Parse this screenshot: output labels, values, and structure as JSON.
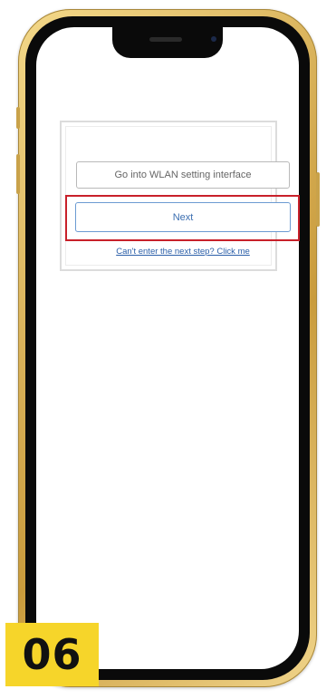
{
  "dialog": {
    "wlan_button_label": "Go into WLAN setting interface",
    "next_button_label": "Next",
    "help_link_text": "Can't enter the next step? Click me"
  },
  "step": {
    "number": "06"
  },
  "colors": {
    "highlight_box": "#c8202a",
    "next_button_border": "#6c9bd2",
    "link": "#2a5ea8",
    "step_badge": "#f6d52a",
    "phone_frame": "#d9b25a"
  }
}
